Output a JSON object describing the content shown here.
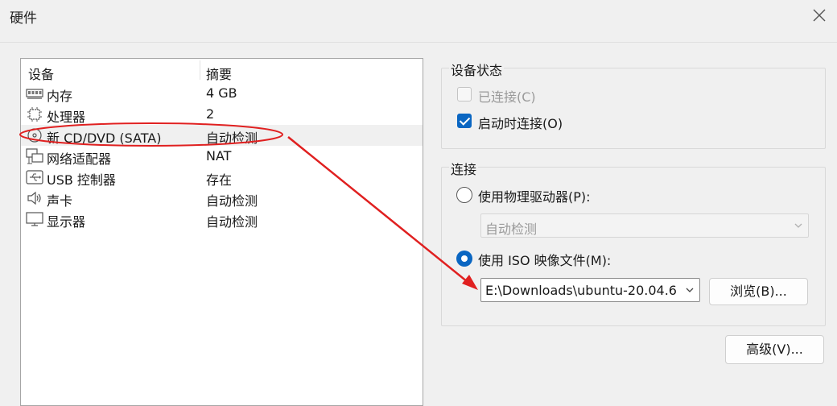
{
  "window": {
    "title": "硬件"
  },
  "device_list": {
    "columns": {
      "device": "设备",
      "summary": "摘要"
    },
    "rows": [
      {
        "icon": "memory-icon",
        "name": "内存",
        "summary": "4 GB"
      },
      {
        "icon": "processor-icon",
        "name": "处理器",
        "summary": "2"
      },
      {
        "icon": "cd-dvd-icon",
        "name": "新 CD/DVD (SATA)",
        "summary": "自动检测",
        "selected": true
      },
      {
        "icon": "network-adapter-icon",
        "name": "网络适配器",
        "summary": "NAT"
      },
      {
        "icon": "usb-icon",
        "name": "USB 控制器",
        "summary": "存在"
      },
      {
        "icon": "sound-card-icon",
        "name": "声卡",
        "summary": "自动检测"
      },
      {
        "icon": "display-icon",
        "name": "显示器",
        "summary": "自动检测"
      }
    ]
  },
  "device_status": {
    "title": "设备状态",
    "connected_label": "已连接(C)",
    "connected_checked": false,
    "connect_at_power_on_label": "启动时连接(O)",
    "connect_at_power_on_checked": true
  },
  "connection": {
    "title": "连接",
    "physical_drive_label": "使用物理驱动器(P):",
    "physical_drive_value": "自动检测",
    "iso_label": "使用 ISO 映像文件(M):",
    "iso_value": "E:\\Downloads\\ubuntu-20.04.6",
    "browse_label": "浏览(B)...",
    "selected_option": "iso"
  },
  "advanced_label": "高级(V)...",
  "colors": {
    "accent": "#0a66c2",
    "annotation": "#e02020"
  }
}
